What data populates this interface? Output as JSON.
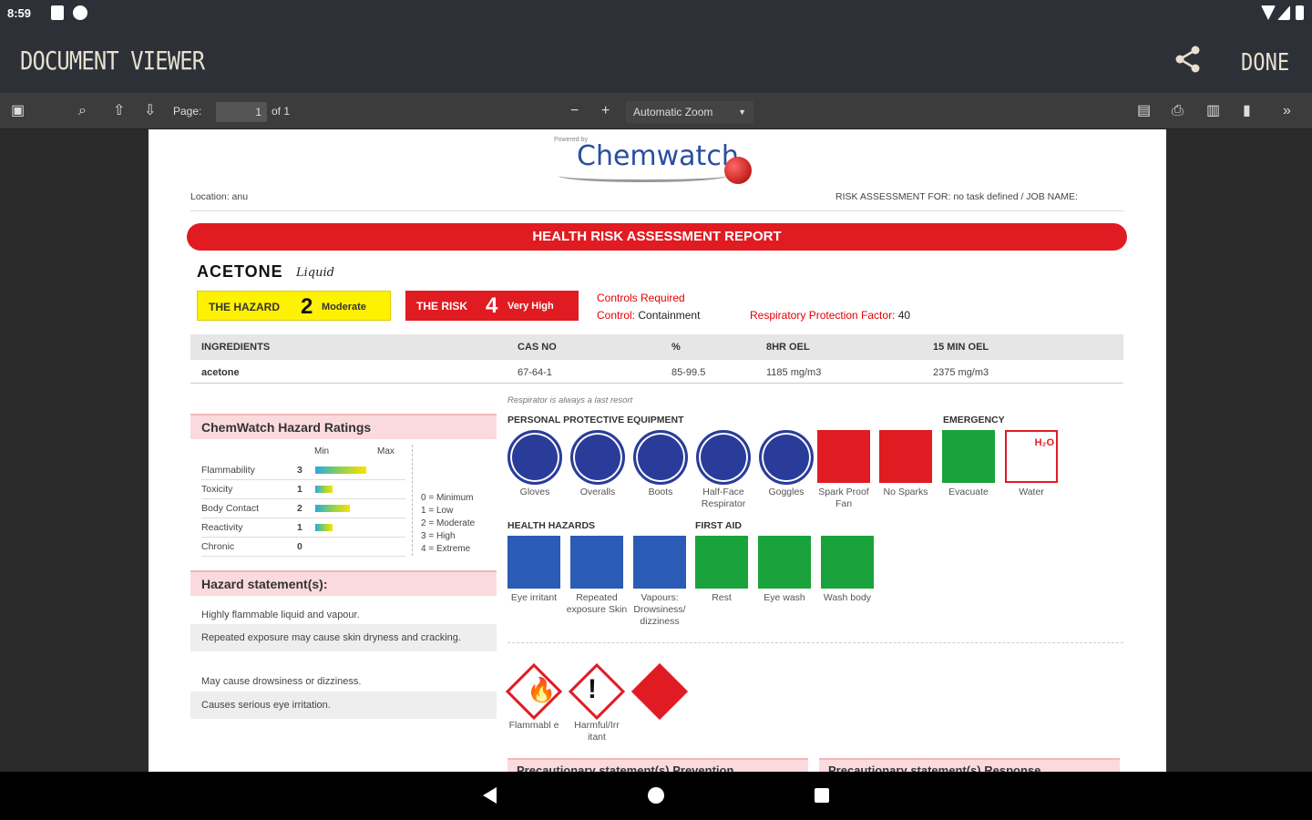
{
  "statusbar": {
    "time": "8:59"
  },
  "appbar": {
    "title": "DOCUMENT VIEWER",
    "done_label": "DONE"
  },
  "toolbar": {
    "page_label": "Page:",
    "page_value": "1",
    "page_total": "of 1",
    "zoom": "Automatic Zoom"
  },
  "report": {
    "logo_small": "Powered by",
    "logo": "Chemwatch",
    "location": "Location: anu",
    "assessment_for": "RISK ASSESSMENT FOR: no task defined / JOB NAME:",
    "banner": "HEALTH RISK ASSESSMENT REPORT",
    "substance": "ACETONE",
    "form": "Liquid",
    "hazard": {
      "label": "THE HAZARD",
      "value": "2",
      "level": "Moderate"
    },
    "risk": {
      "label": "THE RISK",
      "value": "4",
      "level": "Very High"
    },
    "controls_required": "Controls Required",
    "control_label": "Control:",
    "control_value": "Containment",
    "rpf_label": "Respiratory Protection Factor:",
    "rpf_value": "40",
    "table": {
      "headers": [
        "INGREDIENTS",
        "CAS NO",
        "%",
        "8HR OEL",
        "15 MIN OEL"
      ],
      "rows": [
        [
          "acetone",
          "67-64-1",
          "85-99.5",
          "1185 mg/m3",
          "2375 mg/m3"
        ]
      ]
    },
    "ratings_title": "ChemWatch Hazard Ratings",
    "ratings_min": "Min",
    "ratings_max": "Max",
    "ratings": [
      {
        "name": "Flammability",
        "value": "3",
        "level": 0.75
      },
      {
        "name": "Toxicity",
        "value": "1",
        "level": 0.25
      },
      {
        "name": "Body Contact",
        "value": "2",
        "level": 0.5
      },
      {
        "name": "Reactivity",
        "value": "1",
        "level": 0.25
      },
      {
        "name": "Chronic",
        "value": "0",
        "level": 0
      }
    ],
    "scale_legend": [
      "0 = Minimum",
      "1 = Low",
      "2 = Moderate",
      "3 = High",
      "4 = Extreme"
    ],
    "hazard_statements_title": "Hazard statement(s):",
    "hazard_statements": [
      "Highly flammable liquid and vapour.",
      "Repeated exposure may cause skin dryness and cracking.",
      "May cause drowsiness or dizziness.",
      "Causes serious eye irritation."
    ],
    "respirator_note": "Respirator is always a last resort",
    "ppe_title": "PERSONAL PROTECTIVE EQUIPMENT",
    "emergency_title": "EMERGENCY",
    "ppe": [
      "Gloves",
      "Overalls",
      "Boots",
      "Half-Face Respirator",
      "Goggles"
    ],
    "emergency": [
      "Spark Proof Fan",
      "No Sparks",
      "Evacuate",
      "Water"
    ],
    "water_symbol": "H₂O",
    "health_title": "HEALTH HAZARDS",
    "firstaid_title": "FIRST AID",
    "health": [
      "Eye irritant",
      "Repeated exposure Skin",
      "Vapours: Drowsiness/ dizziness"
    ],
    "firstaid": [
      "Rest",
      "Eye wash",
      "Wash body"
    ],
    "ghs": [
      "Flammabl e",
      "Harmful/Irr itant"
    ],
    "precaution_left": "Precautionary statement(s) Prevention",
    "precaution_right": "Precautionary statement(s) Response"
  }
}
